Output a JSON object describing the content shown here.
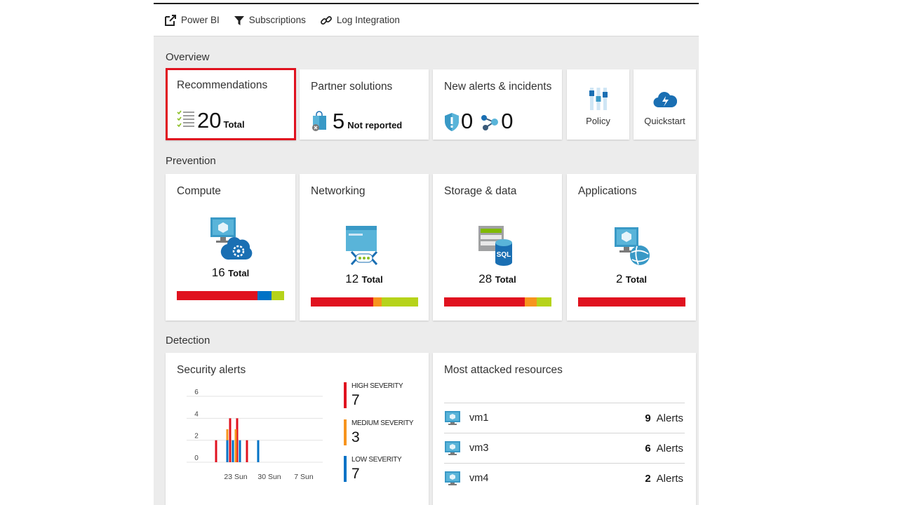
{
  "toolbar": {
    "powerbi": "Power BI",
    "subscriptions": "Subscriptions",
    "log_integration": "Log Integration"
  },
  "sections": {
    "overview": "Overview",
    "prevention": "Prevention",
    "detection": "Detection"
  },
  "overview": {
    "recommendations": {
      "title": "Recommendations",
      "value": "20",
      "label": "Total"
    },
    "partner": {
      "title": "Partner solutions",
      "value": "5",
      "label": "Not reported"
    },
    "alerts": {
      "title": "New alerts & incidents",
      "alerts_value": "0",
      "incidents_value": "0"
    },
    "policy": {
      "label": "Policy"
    },
    "quickstart": {
      "label": "Quickstart"
    }
  },
  "prevention": {
    "compute": {
      "title": "Compute",
      "value": "16",
      "label": "Total",
      "bar": [
        0.75,
        0.13,
        0.12
      ]
    },
    "networking": {
      "title": "Networking",
      "value": "12",
      "label": "Total",
      "bar": [
        0.58,
        0.08,
        0.34
      ]
    },
    "storage": {
      "title": "Storage & data",
      "value": "28",
      "label": "Total",
      "bar": [
        0.75,
        0.11,
        0.14
      ]
    },
    "applications": {
      "title": "Applications",
      "value": "2",
      "label": "Total",
      "bar": [
        1.0,
        0,
        0
      ]
    }
  },
  "colors": {
    "high": "#e0121f",
    "medium": "#f7941d",
    "low": "#0072c6",
    "green": "#b6d31a",
    "accent_highlight": "#e0121f"
  },
  "security_alerts": {
    "title": "Security alerts",
    "high": {
      "label": "HIGH SEVERITY",
      "value": "7"
    },
    "medium": {
      "label": "MEDIUM SEVERITY",
      "value": "3"
    },
    "low": {
      "label": "LOW SEVERITY",
      "value": "7"
    }
  },
  "chart_data": {
    "type": "bar",
    "title": "Security alerts",
    "y_ticks": [
      "6",
      "4",
      "2",
      "0"
    ],
    "x_ticks": [
      "23 Sun",
      "30 Sun",
      "7 Sun"
    ],
    "ylim": [
      0,
      6
    ],
    "grid": true,
    "series": [
      {
        "name": "HIGH SEVERITY",
        "color": "#e0121f",
        "values": [
          2,
          4,
          4,
          2
        ]
      },
      {
        "name": "MEDIUM SEVERITY",
        "color": "#f7941d",
        "values": [
          3,
          3
        ]
      },
      {
        "name": "LOW SEVERITY",
        "color": "#0072c6",
        "values": [
          2,
          2,
          2,
          2
        ]
      }
    ]
  },
  "attacked": {
    "title": "Most attacked resources",
    "rows": [
      {
        "name": "vm1",
        "count": "9",
        "unit": "Alerts"
      },
      {
        "name": "vm3",
        "count": "6",
        "unit": "Alerts"
      },
      {
        "name": "vm4",
        "count": "2",
        "unit": "Alerts"
      }
    ]
  }
}
